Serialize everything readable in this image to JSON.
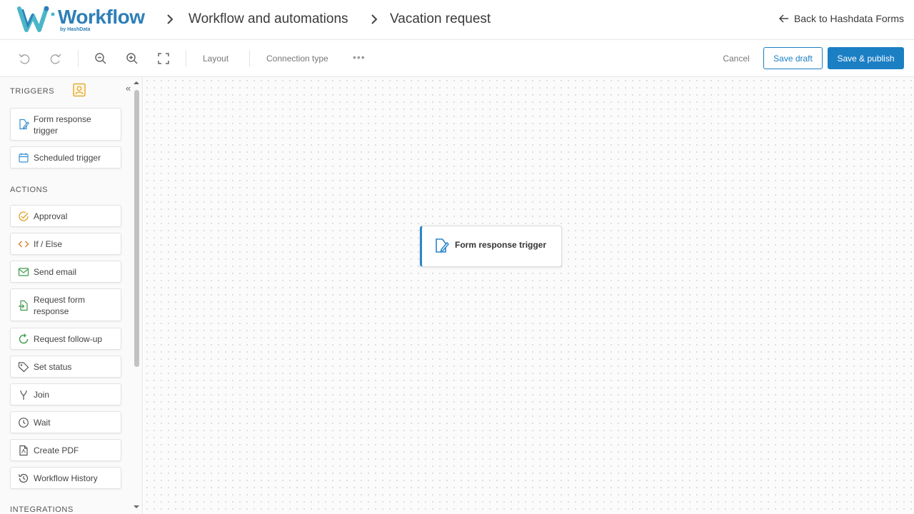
{
  "header": {
    "logo_word": "Workflow",
    "logo_by": "by HashData",
    "breadcrumb": [
      "Workflow and automations",
      "Vacation request"
    ],
    "back_label": "Back to Hashdata Forms"
  },
  "toolbar": {
    "layout_label": "Layout",
    "connection_label": "Connection type",
    "more_label": "•••",
    "cancel_label": "Cancel",
    "save_draft_label": "Save draft",
    "publish_label": "Save & publish"
  },
  "sidebar": {
    "collapse_label": "«",
    "triggers_title": "TRIGGERS",
    "triggers": [
      {
        "label": "Form response trigger",
        "icon": "form-edit-icon"
      },
      {
        "label": "Scheduled trigger",
        "icon": "calendar-icon"
      }
    ],
    "actions_title": "ACTIONS",
    "actions": [
      {
        "label": "Approval",
        "icon": "check-circle-icon"
      },
      {
        "label": "If / Else",
        "icon": "code-icon"
      },
      {
        "label": "Send email",
        "icon": "mail-icon"
      },
      {
        "label": "Request form response",
        "icon": "form-request-icon"
      },
      {
        "label": "Request follow-up",
        "icon": "refresh-icon"
      },
      {
        "label": "Set status",
        "icon": "tag-icon"
      },
      {
        "label": "Join",
        "icon": "merge-icon"
      },
      {
        "label": "Wait",
        "icon": "clock-icon"
      },
      {
        "label": "Create PDF",
        "icon": "pdf-icon"
      },
      {
        "label": "Workflow History",
        "icon": "history-icon"
      }
    ],
    "integrations_title": "INTEGRATIONS"
  },
  "canvas": {
    "node_label": "Form response trigger"
  },
  "colors": {
    "accent": "#1b7fc4",
    "node_border": "#2a86c9",
    "trigger_icon": "#3a8fd0",
    "approval_icon": "#e0a020",
    "ifelse_icon": "#d9822b",
    "green_icon": "#3f9a4a"
  }
}
